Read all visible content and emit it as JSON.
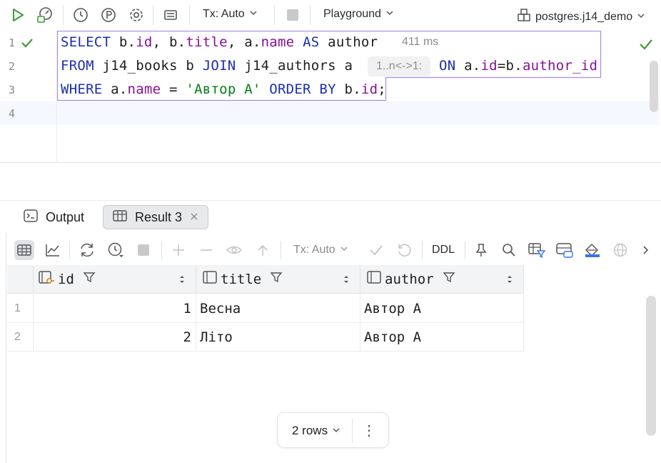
{
  "toolbar": {
    "tx_label": "Tx: Auto",
    "playground_label": "Playground",
    "datasource_label": "postgres.j14_demo",
    "icons": [
      "run-icon",
      "explain-icon",
      "history-icon",
      "pin-p-icon",
      "settings-icon",
      "layout-icon",
      "stop-icon",
      "datasource-icon"
    ]
  },
  "editor": {
    "line_numbers": [
      "1",
      "2",
      "3",
      "4"
    ],
    "lines": [
      [
        {
          "t": "SELECT",
          "c": "kw"
        },
        {
          "t": " b.",
          "c": ""
        },
        {
          "t": "id",
          "c": "fld"
        },
        {
          "t": ", b.",
          "c": ""
        },
        {
          "t": "title",
          "c": "fld"
        },
        {
          "t": ", a.",
          "c": ""
        },
        {
          "t": "name",
          "c": "fld"
        },
        {
          "t": " ",
          "c": ""
        },
        {
          "t": "AS",
          "c": "kw"
        },
        {
          "t": " author",
          "c": ""
        }
      ],
      [
        {
          "t": "FROM",
          "c": "kw"
        },
        {
          "t": " j14_books b ",
          "c": ""
        },
        {
          "t": "JOIN",
          "c": "kw"
        },
        {
          "t": " j14_authors a",
          "c": ""
        }
      ],
      [
        {
          "t": "WHERE",
          "c": "kw"
        },
        {
          "t": " a.",
          "c": ""
        },
        {
          "t": "name",
          "c": "fld"
        },
        {
          "t": " = ",
          "c": ""
        },
        {
          "t": "'Автор А'",
          "c": "str"
        },
        {
          "t": " ",
          "c": ""
        },
        {
          "t": "ORDER BY",
          "c": "kw"
        },
        {
          "t": " b.",
          "c": ""
        },
        {
          "t": "id",
          "c": "fld"
        },
        {
          "t": ";",
          "c": ""
        }
      ]
    ],
    "line2_tail": [
      {
        "t": "ON",
        "c": "kw"
      },
      {
        "t": " a.",
        "c": ""
      },
      {
        "t": "id",
        "c": "fld"
      },
      {
        "t": "=b.",
        "c": ""
      },
      {
        "t": "author_id",
        "c": "fld"
      }
    ],
    "exec_time": "411 ms",
    "inlay_hint": "1..n<->1:"
  },
  "results": {
    "tabs": [
      {
        "label": "Output",
        "active": false
      },
      {
        "label": "Result 3",
        "active": true
      }
    ],
    "grid_toolbar": {
      "tx_label": "Tx: Auto",
      "ddl_label": "DDL"
    },
    "columns": [
      {
        "name": "id",
        "icon": "key-column-icon"
      },
      {
        "name": "title",
        "icon": "column-icon"
      },
      {
        "name": "author",
        "icon": "column-icon"
      }
    ],
    "rows": [
      {
        "n": "1",
        "id": "1",
        "title": "Весна",
        "author": "Автор А"
      },
      {
        "n": "2",
        "id": "2",
        "title": "Літо",
        "author": "Автор А"
      }
    ],
    "row_count_label": "2 rows",
    "more_label": "⋮"
  },
  "colors": {
    "keyword": "#1b2fb1",
    "field": "#871094",
    "string": "#067d17",
    "success": "#3f9c35",
    "statement_border": "#a98af0"
  }
}
